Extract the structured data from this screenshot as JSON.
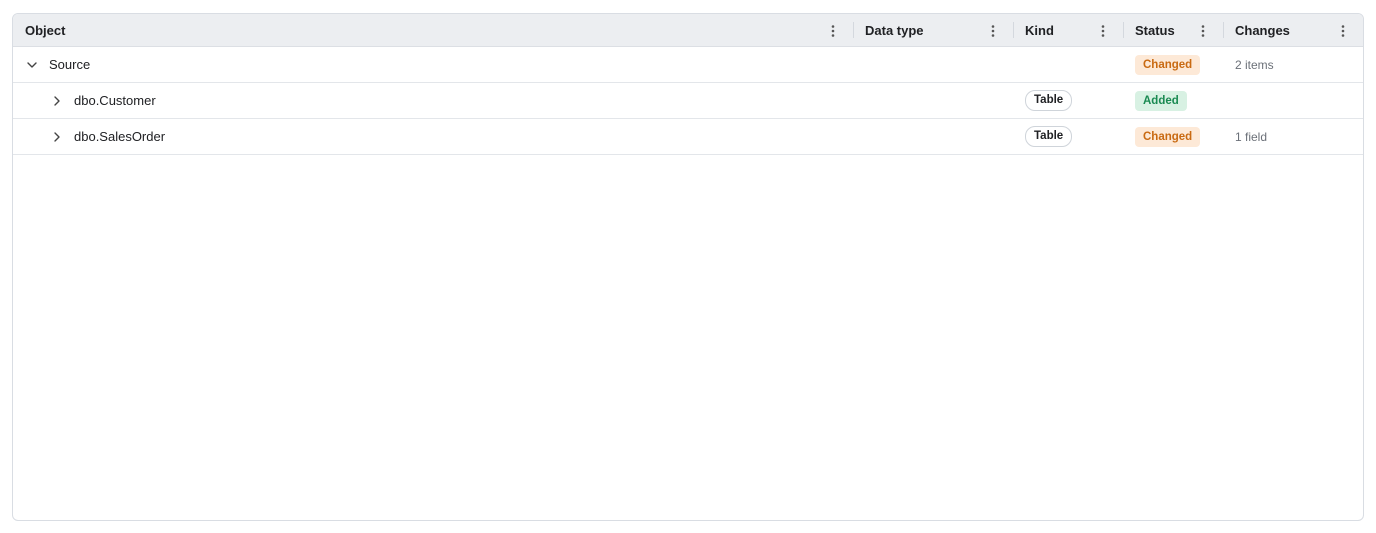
{
  "columns": {
    "object": "Object",
    "data_type": "Data type",
    "kind": "Kind",
    "status": "Status",
    "changes": "Changes"
  },
  "colors": {
    "changed_bg": "#fde9d7",
    "changed_fg": "#c96a12",
    "added_bg": "#d8f1e3",
    "added_fg": "#1a8a52"
  },
  "rows": [
    {
      "name": "Source",
      "expanded": true,
      "data_type": "",
      "kind": "",
      "status": "Changed",
      "changes": "2 items"
    },
    {
      "name": "dbo.Customer",
      "expanded": false,
      "data_type": "",
      "kind": "Table",
      "status": "Added",
      "changes": ""
    },
    {
      "name": "dbo.SalesOrder",
      "expanded": false,
      "data_type": "",
      "kind": "Table",
      "status": "Changed",
      "changes": "1 field"
    }
  ]
}
